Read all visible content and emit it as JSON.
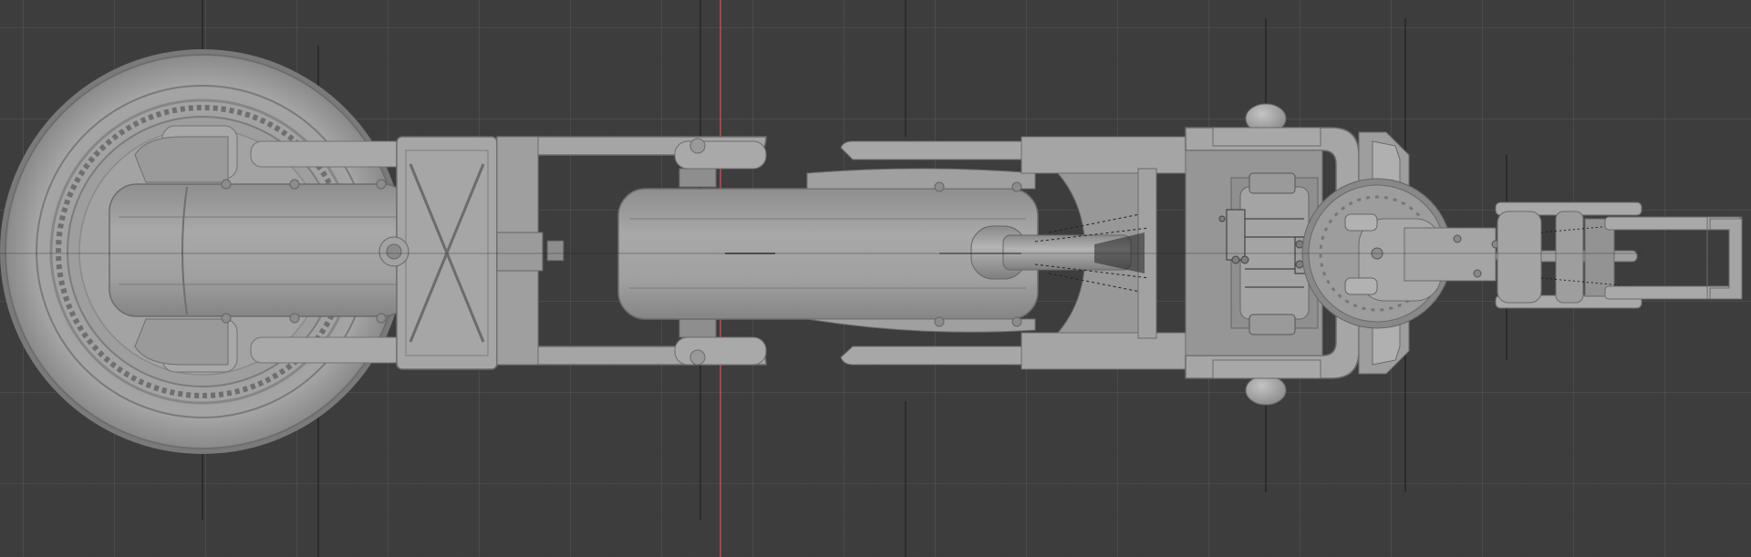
{
  "viewport": {
    "background": "#3d3d3d",
    "grid_minor": "#474747",
    "grid_major": "#555555",
    "y_axis_color": "#c0555f"
  },
  "model": {
    "name": "robotic-arm",
    "parts": [
      "base-turntable",
      "shoulder-joint",
      "x-brace-bracket",
      "upper-arm-link",
      "elbow-joint",
      "hydraulic-piston",
      "forearm-frame",
      "wrist-actuator",
      "wrist-flange",
      "gripper"
    ],
    "shade": "#9c9c9c"
  }
}
